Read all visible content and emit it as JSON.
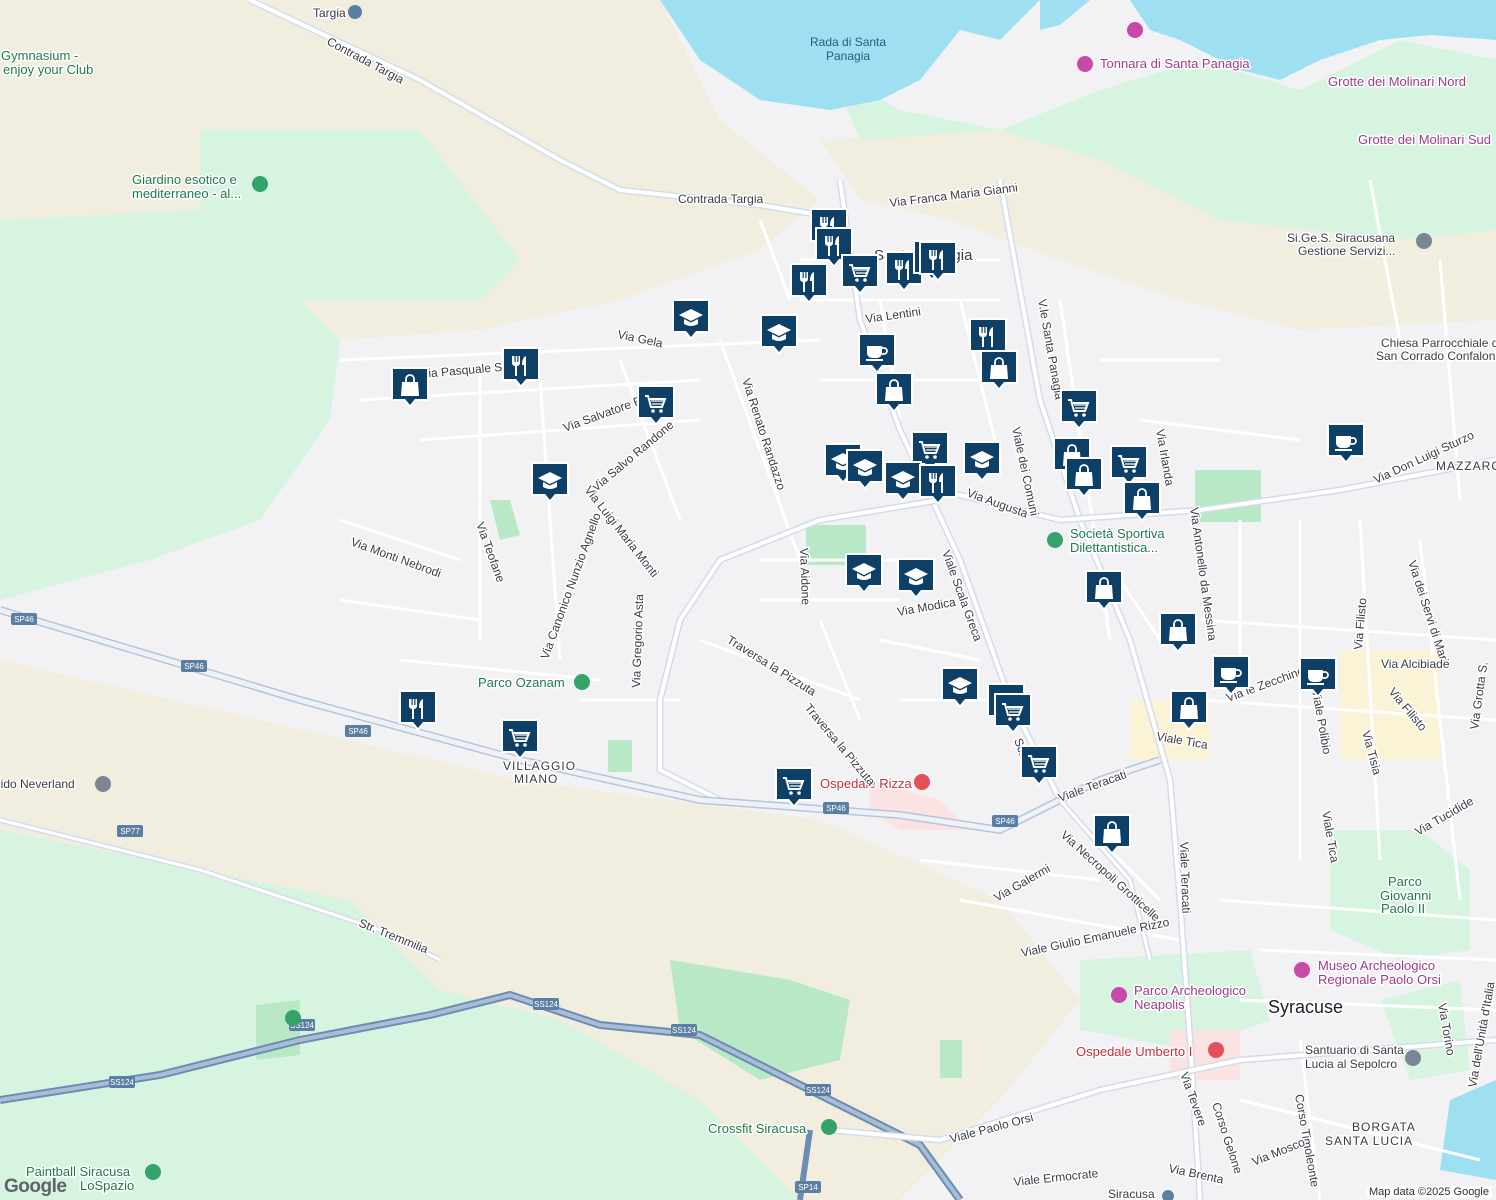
{
  "map": {
    "attribution": "Map data ©2025 Google",
    "logo": "Google",
    "places": [
      {
        "id": "targia",
        "text": "Targia"
      },
      {
        "id": "gymnasium1",
        "text": "Gymnasium -"
      },
      {
        "id": "gymnasium2",
        "text": "enjoy your Club"
      },
      {
        "id": "rada1",
        "text": "Rada di Santa"
      },
      {
        "id": "rada2",
        "text": "Panagia"
      },
      {
        "id": "tonnara",
        "text": "Tonnara di Santa Panagia"
      },
      {
        "id": "molinari-nord",
        "text": "Grotte dei Molinari Nord"
      },
      {
        "id": "molinari-sud",
        "text": "Grotte dei Molinari Sud"
      },
      {
        "id": "giardino1",
        "text": "Giardino esotico e"
      },
      {
        "id": "giardino2",
        "text": "mediterraneo - al..."
      },
      {
        "id": "sige1",
        "text": "Si.Ge.S. Siracusana"
      },
      {
        "id": "sige2",
        "text": "Gestione Servizi..."
      },
      {
        "id": "santa-panagia",
        "text": "Santa Panagia"
      },
      {
        "id": "chiesa1",
        "text": "Chiesa Parrocchiale di"
      },
      {
        "id": "chiesa2",
        "text": "San Corrado Confalonieri"
      },
      {
        "id": "mazzarona",
        "text": "MAZZARONA"
      },
      {
        "id": "societa1",
        "text": "Società Sportiva"
      },
      {
        "id": "societa2",
        "text": "Dilettantistica..."
      },
      {
        "id": "parco-ozanam",
        "text": "Parco Ozanam"
      },
      {
        "id": "villaggio1",
        "text": "VILLAGGIO"
      },
      {
        "id": "villaggio2",
        "text": "MIANO"
      },
      {
        "id": "neverland",
        "text": "lido Neverland"
      },
      {
        "id": "ospedale-rizza",
        "text": "Ospedale Rizza"
      },
      {
        "id": "parco-giovanni1",
        "text": "Parco"
      },
      {
        "id": "parco-giovanni2",
        "text": "Giovanni"
      },
      {
        "id": "parco-giovanni3",
        "text": "Paolo II"
      },
      {
        "id": "museo1",
        "text": "Museo Archeologico"
      },
      {
        "id": "museo2",
        "text": "Regionale Paolo Orsi"
      },
      {
        "id": "neapolis1",
        "text": "Parco Archeologico"
      },
      {
        "id": "neapolis2",
        "text": "Neapolis"
      },
      {
        "id": "syracuse",
        "text": "Syracuse"
      },
      {
        "id": "umberto",
        "text": "Ospedale Umberto I"
      },
      {
        "id": "santuario1",
        "text": "Santuario di Santa"
      },
      {
        "id": "santuario2",
        "text": "Lucia al Sepolcro"
      },
      {
        "id": "borgata1",
        "text": "BORGATA"
      },
      {
        "id": "borgata2",
        "text": "SANTA LUCIA"
      },
      {
        "id": "crossfit",
        "text": "Crossfit Siracusa"
      },
      {
        "id": "paintball1",
        "text": "Paintball Siracusa"
      },
      {
        "id": "paintball2",
        "text": "LoSpazio"
      },
      {
        "id": "siracusa-station",
        "text": "Siracusa"
      }
    ],
    "streets": [
      {
        "id": "contrada-targia-1",
        "text": "Contrada Targia"
      },
      {
        "id": "contrada-targia-2",
        "text": "Contrada Targia"
      },
      {
        "id": "franca-maria-gianni",
        "text": "Via Franca Maria Gianni"
      },
      {
        "id": "via-gela",
        "text": "Via Gela"
      },
      {
        "id": "via-lentini",
        "text": "Via Lentini"
      },
      {
        "id": "pasquale-salibra",
        "text": "Via Pasquale Salibra"
      },
      {
        "id": "salvatore-raiti",
        "text": "Via Salvatore Raiti"
      },
      {
        "id": "salvo-randone",
        "text": "Via Salvo Randone"
      },
      {
        "id": "renato-randazzo",
        "text": "Via Renato Randazzo"
      },
      {
        "id": "via-augusta",
        "text": "Via Augusta"
      },
      {
        "id": "viale-dei-comuni",
        "text": "Viale dei Comuni"
      },
      {
        "id": "vle-santa-panagia",
        "text": "V.le Santa Panagia"
      },
      {
        "id": "viale-scala-greca",
        "text": "Viale Scala Greca"
      },
      {
        "id": "via-irlanda",
        "text": "Via Irlanda"
      },
      {
        "id": "via-teofane",
        "text": "Via Teofane"
      },
      {
        "id": "via-monti-nebrodi",
        "text": "Via Monti Nebrodi"
      },
      {
        "id": "luigi-maria-monti",
        "text": "Via Luigi Maria Monti"
      },
      {
        "id": "canonico-nunzio",
        "text": "Via Canonico Nunzio Agnello"
      },
      {
        "id": "gregorio-asta",
        "text": "Via Gregorio Asta"
      },
      {
        "id": "via-aidone",
        "text": "Via Aidone"
      },
      {
        "id": "via-modica",
        "text": "Via Modica"
      },
      {
        "id": "traversa-pizzuta-1",
        "text": "Traversa la Pizzuta"
      },
      {
        "id": "traversa-pizzuta-2",
        "text": "Traversa la Pizzuta"
      },
      {
        "id": "antonello-da-messina",
        "text": "Via Antonello da Messina"
      },
      {
        "id": "don-luigi-sturzo",
        "text": "Via Don Luigi Sturzo"
      },
      {
        "id": "via-dei-servi-di-maria",
        "text": "Via dei Servi di Maria"
      },
      {
        "id": "via-filisto-1",
        "text": "Via Filisto"
      },
      {
        "id": "via-alcibiade",
        "text": "Via Alcibiade"
      },
      {
        "id": "via-zecchino",
        "text": "Via le Zecchino"
      },
      {
        "id": "viale-polibio",
        "text": "Viale Polibio"
      },
      {
        "id": "via-filisto-2",
        "text": "Via Filisto"
      },
      {
        "id": "via-tisia",
        "text": "Via Tisia"
      },
      {
        "id": "via-grotta",
        "text": "Via Grotta S."
      },
      {
        "id": "viale-tica-1",
        "text": "Viale Tica"
      },
      {
        "id": "viale-tica-2",
        "text": "Viale Tica"
      },
      {
        "id": "via-tucidide",
        "text": "Via Tucidide"
      },
      {
        "id": "viale-teracati-1",
        "text": "Viale Teracati"
      },
      {
        "id": "viale-teracati-2",
        "text": "Viale Teracati"
      },
      {
        "id": "necropoli",
        "text": "Via Necropoli Grotticelle"
      },
      {
        "id": "via-galermi",
        "text": "Via Galermi"
      },
      {
        "id": "giulio-emanuele-rizzo",
        "text": "Viale Giulio Emanuele Rizzo"
      },
      {
        "id": "str-tremmilia",
        "text": "Str. Tremmilia"
      },
      {
        "id": "viale-paolo-orsi",
        "text": "Viale Paolo Orsi"
      },
      {
        "id": "viale-ermocrate",
        "text": "Viale Ermocrate"
      },
      {
        "id": "corso-gelone",
        "text": "Corso Gelone"
      },
      {
        "id": "corso-timoleonte",
        "text": "Corso Timoleonte"
      },
      {
        "id": "via-tevere",
        "text": "Via Tevere"
      },
      {
        "id": "via-brenta",
        "text": "Via Brenta"
      },
      {
        "id": "via-mosco",
        "text": "Via Mosco"
      },
      {
        "id": "via-torino",
        "text": "Via Torino"
      },
      {
        "id": "via-unita-italia",
        "text": "Via dell'Unità d'Italia"
      },
      {
        "id": "scala-greca-short",
        "text": "Sca"
      }
    ],
    "road_shields": [
      {
        "id": "sp46-a",
        "text": "SP46"
      },
      {
        "id": "sp46-b",
        "text": "SP46"
      },
      {
        "id": "sp46-c",
        "text": "SP46"
      },
      {
        "id": "sp46-d",
        "text": "SP46"
      },
      {
        "id": "sp46-e",
        "text": "SP46"
      },
      {
        "id": "sp77",
        "text": "SP77"
      },
      {
        "id": "ss124-a",
        "text": "SS124"
      },
      {
        "id": "ss124-b",
        "text": "SS124"
      },
      {
        "id": "ss124-c",
        "text": "SS124"
      },
      {
        "id": "ss124-d",
        "text": "SS124"
      },
      {
        "id": "ss124-e",
        "text": "SS124"
      },
      {
        "id": "sp14",
        "text": "SP14"
      }
    ],
    "marker_color": "#0e3f66",
    "markers": [
      {
        "id": "m1",
        "icon": "restaurant-icon"
      },
      {
        "id": "m2",
        "icon": "restaurant-icon"
      },
      {
        "id": "m3",
        "icon": "restaurant-icon"
      },
      {
        "id": "m4",
        "icon": "restaurant-icon"
      },
      {
        "id": "m5",
        "icon": "restaurant-icon"
      },
      {
        "id": "m6",
        "icon": "restaurant-icon"
      },
      {
        "id": "m7",
        "icon": "shopping-cart-icon"
      },
      {
        "id": "m8",
        "icon": "school-icon"
      },
      {
        "id": "m9",
        "icon": "school-icon"
      },
      {
        "id": "m10",
        "icon": "restaurant-icon"
      },
      {
        "id": "m11",
        "icon": "shopping-bag-icon"
      },
      {
        "id": "m12",
        "icon": "shopping-cart-icon"
      },
      {
        "id": "m13",
        "icon": "cafe-icon"
      },
      {
        "id": "m14",
        "icon": "restaurant-icon"
      },
      {
        "id": "m15",
        "icon": "shopping-bag-icon"
      },
      {
        "id": "m16",
        "icon": "shopping-bag-icon"
      },
      {
        "id": "m17",
        "icon": "shopping-cart-icon"
      },
      {
        "id": "m18",
        "icon": "school-icon"
      },
      {
        "id": "m19",
        "icon": "school-icon"
      },
      {
        "id": "m20",
        "icon": "shopping-cart-icon"
      },
      {
        "id": "m21",
        "icon": "school-icon"
      },
      {
        "id": "m22",
        "icon": "restaurant-icon"
      },
      {
        "id": "m23",
        "icon": "school-icon"
      },
      {
        "id": "m24",
        "icon": "school-icon"
      },
      {
        "id": "m25",
        "icon": "shopping-bag-icon"
      },
      {
        "id": "m26",
        "icon": "shopping-cart-icon"
      },
      {
        "id": "m27",
        "icon": "shopping-bag-icon"
      },
      {
        "id": "m28",
        "icon": "shopping-bag-icon"
      },
      {
        "id": "m29",
        "icon": "cafe-icon"
      },
      {
        "id": "m30",
        "icon": "school-icon"
      },
      {
        "id": "m31",
        "icon": "school-icon"
      },
      {
        "id": "m32",
        "icon": "shopping-bag-icon"
      },
      {
        "id": "m33",
        "icon": "shopping-bag-icon"
      },
      {
        "id": "m34",
        "icon": "cafe-icon"
      },
      {
        "id": "m35",
        "icon": "cafe-icon"
      },
      {
        "id": "m36",
        "icon": "shopping-bag-icon"
      },
      {
        "id": "m37",
        "icon": "school-icon"
      },
      {
        "id": "m38",
        "icon": "shopping-cart-icon"
      },
      {
        "id": "m39",
        "icon": "shopping-cart-icon"
      },
      {
        "id": "m40",
        "icon": "shopping-cart-icon"
      },
      {
        "id": "m41",
        "icon": "restaurant-icon"
      },
      {
        "id": "m42",
        "icon": "shopping-cart-icon"
      },
      {
        "id": "m43",
        "icon": "shopping-cart-icon"
      },
      {
        "id": "m44",
        "icon": "shopping-bag-icon"
      }
    ]
  }
}
